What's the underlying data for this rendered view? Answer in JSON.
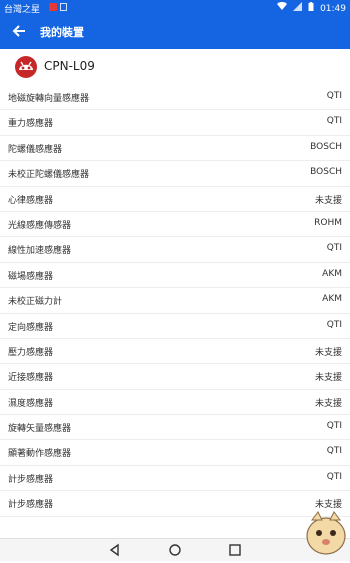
{
  "status_bar": {
    "carrier": "台灣之星",
    "time": "01:49",
    "icons": [
      "wifi-icon",
      "signal-icon",
      "battery-icon"
    ]
  },
  "app_bar": {
    "back_icon": "arrow-back-icon",
    "title": "我的裝置"
  },
  "device": {
    "logo": "antutu-logo",
    "name": "CPN-L09"
  },
  "sensors": [
    {
      "label": "地磁旋轉向量感應器",
      "vendor": "QTI"
    },
    {
      "label": "重力感應器",
      "vendor": "QTI"
    },
    {
      "label": "陀螺儀感應器",
      "vendor": "BOSCH"
    },
    {
      "label": "未校正陀螺儀感應器",
      "vendor": "BOSCH"
    },
    {
      "label": "心律感應器",
      "vendor": "未支援"
    },
    {
      "label": "光線感應傳感器",
      "vendor": "ROHM"
    },
    {
      "label": "線性加速感應器",
      "vendor": "QTI"
    },
    {
      "label": "磁場感應器",
      "vendor": "AKM"
    },
    {
      "label": "未校正磁力計",
      "vendor": "AKM"
    },
    {
      "label": "定向感應器",
      "vendor": "QTI"
    },
    {
      "label": "壓力感應器",
      "vendor": "未支援"
    },
    {
      "label": "近接感應器",
      "vendor": "未支援"
    },
    {
      "label": "濕度感應器",
      "vendor": "未支援"
    },
    {
      "label": "旋轉矢量感應器",
      "vendor": "QTI"
    },
    {
      "label": "顯著動作感應器",
      "vendor": "QTI"
    },
    {
      "label": "計步感應器",
      "vendor": "QTI"
    },
    {
      "label": "計步感應器",
      "vendor": "未支援"
    }
  ],
  "nav_bar": {
    "back_icon": "nav-back-icon",
    "home_icon": "nav-home-icon",
    "recent_icon": "nav-recent-icon"
  },
  "colors": {
    "accent": "#1565e3",
    "logo_red": "#c62828"
  }
}
